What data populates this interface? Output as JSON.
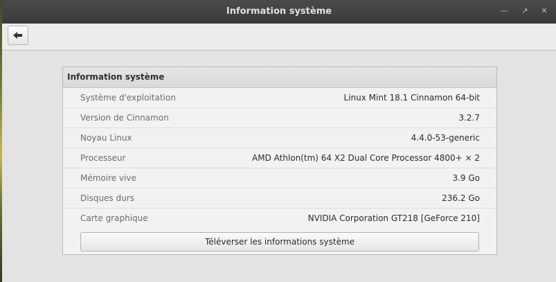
{
  "window": {
    "title": "Information système"
  },
  "toolbar": {
    "back_icon": "arrow-left-icon"
  },
  "panel": {
    "header": "Information système",
    "rows": [
      {
        "label": "Système d'exploitation",
        "value": "Linux Mint 18.1 Cinnamon 64-bit"
      },
      {
        "label": "Version de Cinnamon",
        "value": "3.2.7"
      },
      {
        "label": "Noyau Linux",
        "value": "4.4.0-53-generic"
      },
      {
        "label": "Processeur",
        "value": "AMD Athlon(tm) 64 X2 Dual Core Processor 4800+ × 2"
      },
      {
        "label": "Mémoire vive",
        "value": "3.9 Go"
      },
      {
        "label": "Disques durs",
        "value": "236.2 Go"
      },
      {
        "label": "Carte graphique",
        "value": "NVIDIA Corporation GT218 [GeForce 210]"
      }
    ],
    "upload_label": "Téléverser les informations système"
  }
}
